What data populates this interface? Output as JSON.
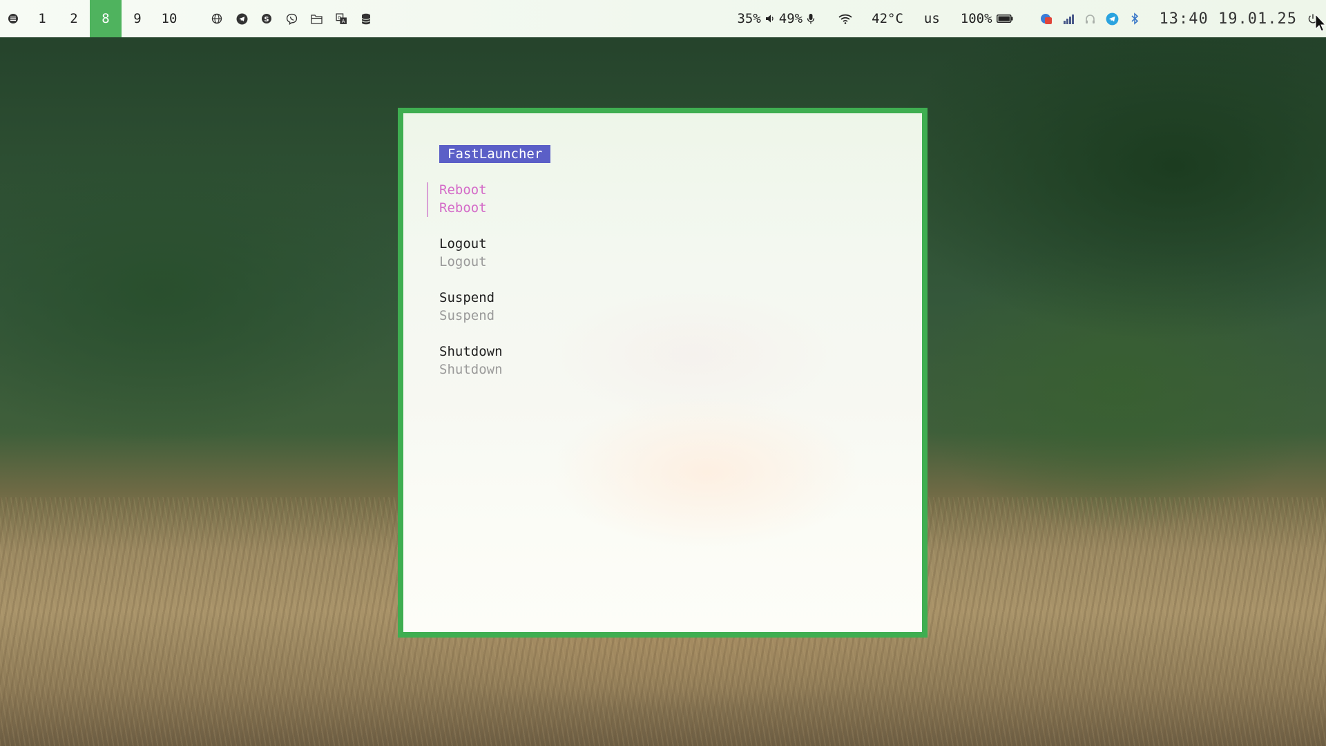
{
  "topbar": {
    "workspaces": [
      "1",
      "2",
      "8",
      "9",
      "10"
    ],
    "active_workspace": "8",
    "volume": "35%",
    "mic": "49%",
    "temperature": "42°C",
    "keyboard_layout": "us",
    "battery": "100%",
    "time": "13:40",
    "date": "19.01.25",
    "left_icons": [
      "globe-icon",
      "telegram-icon",
      "skype-icon",
      "viber-icon",
      "files-icon",
      "translate-icon",
      "database-icon"
    ],
    "tray_icons": [
      "notification-app-icon",
      "signal-bars-icon",
      "headphones-icon",
      "telegram-icon",
      "bluetooth-icon"
    ],
    "colors": {
      "active_workspace_bg": "#4fb35e"
    }
  },
  "launcher": {
    "title": "FastLauncher",
    "entries": [
      {
        "name": "Reboot",
        "description": "Reboot",
        "selected": true
      },
      {
        "name": "Logout",
        "description": "Logout",
        "selected": false
      },
      {
        "name": "Suspend",
        "description": "Suspend",
        "selected": false
      },
      {
        "name": "Shutdown",
        "description": "Shutdown",
        "selected": false
      }
    ],
    "colors": {
      "border": "#3fae51",
      "title_bg": "#5b5fc7",
      "selected_text": "#d46bc8"
    }
  }
}
